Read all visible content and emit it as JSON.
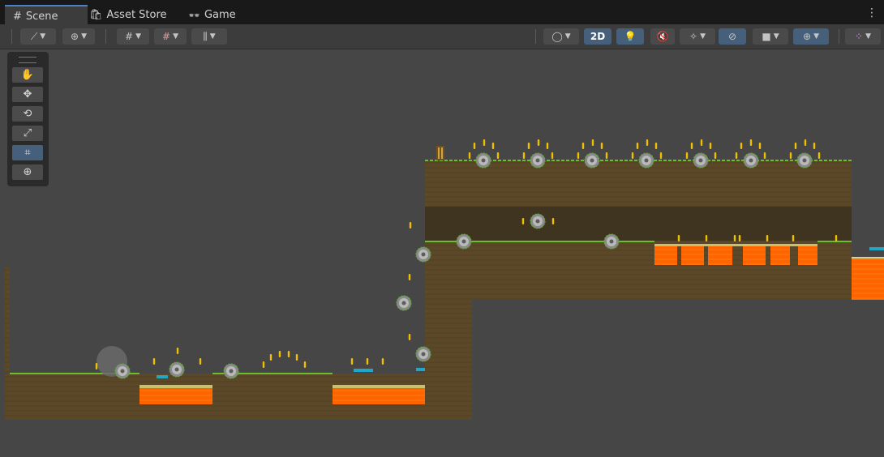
{
  "tabs": [
    {
      "label": "Scene",
      "icon": "#",
      "active": true
    },
    {
      "label": "Asset Store",
      "icon": "bag-icon",
      "active": false
    },
    {
      "label": "Game",
      "icon": "gamepad-icon",
      "active": false
    }
  ],
  "toolbar": {
    "two_d_label": "2D",
    "colors": {
      "accent": "#46607c",
      "button": "#4a4a4a"
    }
  },
  "tools": [
    {
      "name": "hand-tool",
      "glyph": "✋",
      "selected": false
    },
    {
      "name": "move-tool",
      "glyph": "✥",
      "selected": false
    },
    {
      "name": "rotate-tool",
      "glyph": "⟲",
      "selected": false
    },
    {
      "name": "scale-tool",
      "glyph": "⤢",
      "selected": false
    },
    {
      "name": "rect-tool",
      "glyph": "⌗",
      "selected": true
    },
    {
      "name": "transform-tool",
      "glyph": "⊕",
      "selected": false
    }
  ],
  "scene_colors": {
    "background": "#464646",
    "dirt": "#5c4a2a",
    "grass": "#6bbf2e",
    "lava": "#ff6a00",
    "water": "#22a6c4",
    "coin": "#f0c000"
  }
}
